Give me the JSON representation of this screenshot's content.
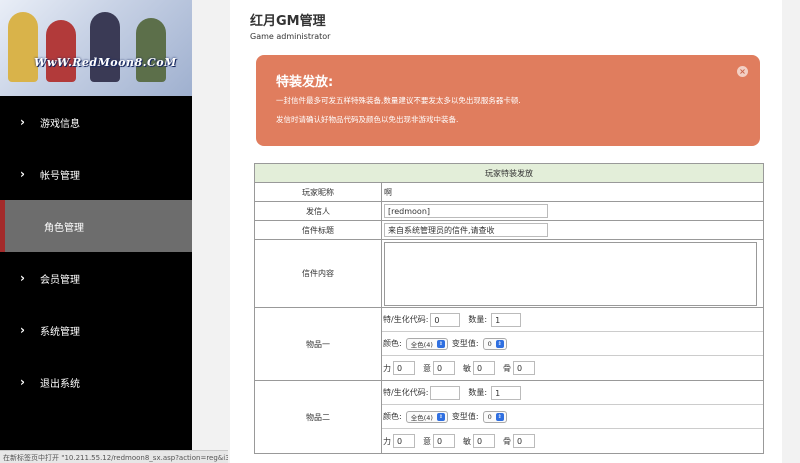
{
  "sidebar": {
    "logo_text": "WwW.RedMoon8.CoM",
    "items": [
      {
        "label": "游戏信息"
      },
      {
        "label": "帐号管理"
      },
      {
        "label": "角色管理"
      },
      {
        "label": "会员管理"
      },
      {
        "label": "系统管理"
      },
      {
        "label": "退出系统"
      }
    ]
  },
  "status_bar": "在新标签页中打开 \"10.211.55.12/redmoon8_sx.asp?action=reg&i3=active\"",
  "header": {
    "title": "红月GM管理",
    "subtitle": "Game administrator"
  },
  "alert": {
    "title": "特装发放:",
    "line1": "一封信件最多可发五样特殊装备,数量建议不要发太多以免出现服务器卡顿.",
    "line2": "发信时请确认好物品代码及颜色以免出现非游戏中装备.",
    "close": "×"
  },
  "form": {
    "heading": "玩家特装发放",
    "nickname_label": "玩家昵称",
    "nickname_value": "啊",
    "sender_label": "发信人",
    "sender_value": "[redmoon]",
    "subject_label": "信件标题",
    "subject_value": "来自系统管理员的信件,请查收",
    "content_label": "信件内容",
    "item1": {
      "label": "物品一",
      "code_label": "特/生化代码:",
      "code_value": "0",
      "qty_label": "数量:",
      "qty_value": "1",
      "color_label": "颜色:",
      "color_value": "全色(4)",
      "morph_label": "变型值:",
      "morph_value": "0",
      "str_label": "力",
      "str_value": "0",
      "will_label": "意",
      "will_value": "0",
      "agi_label": "敏",
      "agi_value": "0",
      "bone_label": "骨",
      "bone_value": "0"
    },
    "item2": {
      "label": "物品二",
      "code_label": "特/生化代码:",
      "code_value": "",
      "qty_label": "数量:",
      "qty_value": "1",
      "color_label": "颜色:",
      "color_value": "全色(4)",
      "morph_label": "变型值:",
      "morph_value": "0",
      "str_label": "力",
      "str_value": "0",
      "will_label": "意",
      "will_value": "0",
      "agi_label": "敏",
      "agi_value": "0",
      "bone_label": "骨",
      "bone_value": "0"
    }
  },
  "icons": {
    "nav_chevron": "chevron-right-icon",
    "close": "close-icon",
    "select_arrow": "select-arrows-icon"
  },
  "colors": {
    "sidebar_bg": "#000000",
    "active_item_bg": "#6d6d6d",
    "active_marker": "#a32a2a",
    "alert_bg": "#e07d5e",
    "table_heading_bg": "#e3eed9"
  }
}
